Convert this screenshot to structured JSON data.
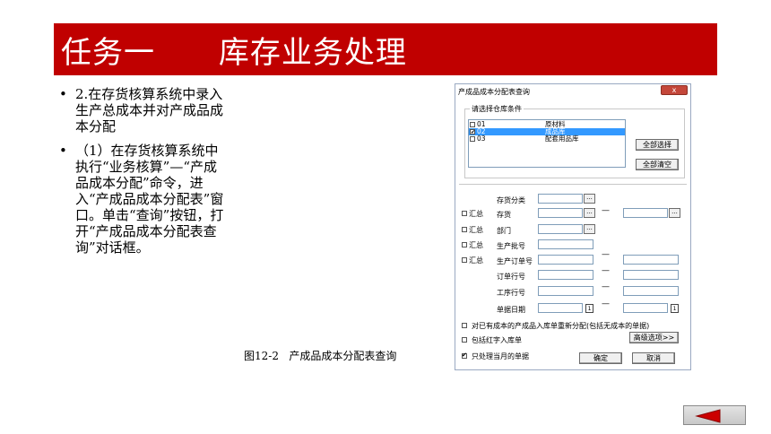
{
  "header": {
    "title": "任务一      库存业务处理"
  },
  "bullets": [
    "2.在存货核算系统中录入生产总成本并对产成品成本分配",
    "（1）在存货核算系统中执行“业务核算”—“产成品成本分配”命令，进入“产成品成本分配表”窗口。单击“查询”按钮，打开“产成品成本分配表查询”对话框。"
  ],
  "bullet_marker": "•",
  "caption": "图12-2   产成品成本分配表查询",
  "dialog": {
    "title": "产成品成本分配表查询",
    "close_label": "x",
    "group_label": "请选择仓库条件",
    "warehouses": [
      {
        "code": "01",
        "name": "原材料",
        "checked": false,
        "selected": false
      },
      {
        "code": "02",
        "name": "成品库",
        "checked": true,
        "selected": true
      },
      {
        "code": "03",
        "name": "配套用品库",
        "checked": false,
        "selected": false
      }
    ],
    "select_all": "全部选择",
    "clear_all": "全部清空",
    "summary_label": "汇总",
    "fields": {
      "inv_class": "存货分类",
      "inventory": "存货",
      "department": "部门",
      "batch": "生产批号",
      "prod_order": "生产订单号",
      "order_line": "订单行号",
      "proc_line": "工序行号",
      "doc_date": "单据日期"
    },
    "ellipsis": "...",
    "range_dash": "—",
    "calendar_glyph": "1",
    "options": [
      {
        "label": "对已有成本的产成品入库单重新分配(包括无成本的单据)",
        "checked": false
      },
      {
        "label": "包括红字入库单",
        "checked": false
      },
      {
        "label": "只处理当月的单据",
        "checked": true
      }
    ],
    "advanced": "高级选项>>",
    "ok": "确定",
    "cancel": "取消"
  },
  "nav": {
    "icon": "back-arrow-icon",
    "color": "#cc0000"
  }
}
